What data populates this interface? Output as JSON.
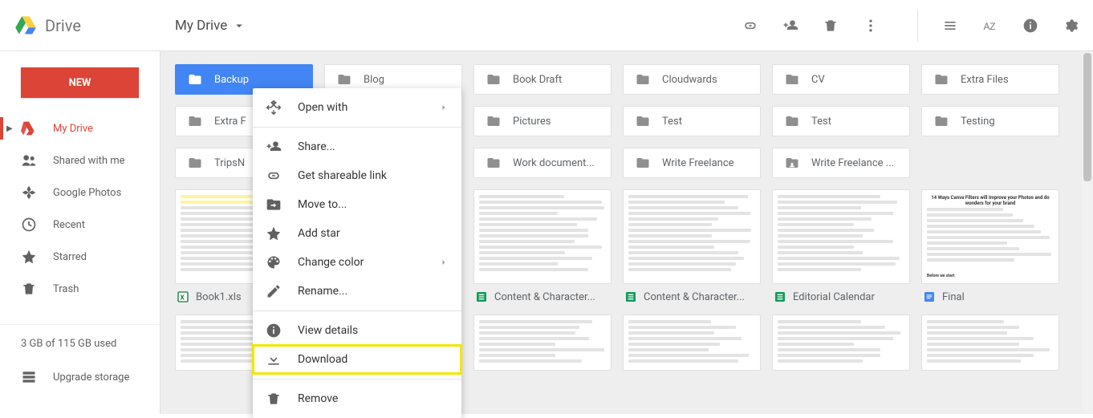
{
  "header": {
    "app_name": "Drive",
    "breadcrumb": "My Drive"
  },
  "sidebar": {
    "new_label": "NEW",
    "items": [
      {
        "label": "My Drive",
        "active": true
      },
      {
        "label": "Shared with me"
      },
      {
        "label": "Google Photos"
      },
      {
        "label": "Recent"
      },
      {
        "label": "Starred"
      },
      {
        "label": "Trash"
      }
    ],
    "storage_text": "3 GB of 115 GB used",
    "upgrade_label": "Upgrade storage"
  },
  "folders_row1": [
    {
      "label": "Backup",
      "selected": true
    },
    {
      "label": "Blog"
    },
    {
      "label": "Book Draft"
    },
    {
      "label": "Cloudwards"
    },
    {
      "label": "CV"
    },
    {
      "label": "Extra Files"
    }
  ],
  "folders_row2": [
    {
      "label": "Extra F"
    },
    {
      "label": ""
    },
    {
      "label": "Pictures"
    },
    {
      "label": "Test"
    },
    {
      "label": "Test"
    },
    {
      "label": "Testing"
    }
  ],
  "folders_row3": [
    {
      "label": "TripsN"
    },
    {
      "label": ""
    },
    {
      "label": "Work document..."
    },
    {
      "label": "Write Freelance"
    },
    {
      "label": "Write Freelance ...",
      "shared": true
    },
    {
      "label": ""
    }
  ],
  "files_row1": [
    {
      "label": "Book1.xls",
      "type": "excel"
    },
    {
      "label": ""
    },
    {
      "label": "Content & Character...",
      "type": "sheets"
    },
    {
      "label": "Content & Character...",
      "type": "sheets"
    },
    {
      "label": "Editorial Calendar",
      "type": "sheets"
    },
    {
      "label": "Final",
      "type": "docs"
    }
  ],
  "file_preview_title": "14 Ways Canva Filters will Improve your Photos and do wonders for your brand",
  "file_preview_sub": "Before we start",
  "context_menu": [
    {
      "label": "Open with",
      "icon": "open",
      "arrow": true
    },
    {
      "sep": true
    },
    {
      "label": "Share...",
      "icon": "share"
    },
    {
      "label": "Get shareable link",
      "icon": "link"
    },
    {
      "label": "Move to...",
      "icon": "moveto"
    },
    {
      "label": "Add star",
      "icon": "star"
    },
    {
      "label": "Change color",
      "icon": "palette",
      "arrow": true
    },
    {
      "label": "Rename...",
      "icon": "rename"
    },
    {
      "sep": true
    },
    {
      "label": "View details",
      "icon": "info"
    },
    {
      "label": "Download",
      "icon": "download",
      "highlight": true
    },
    {
      "sep": true
    },
    {
      "label": "Remove",
      "icon": "trash"
    }
  ]
}
